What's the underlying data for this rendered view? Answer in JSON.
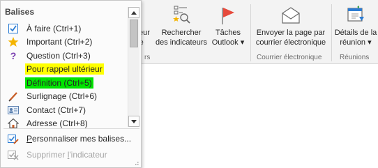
{
  "tags_menu": {
    "header": "Balises",
    "items": [
      {
        "icon": "checkbox-icon",
        "label": "À faire (Ctrl+1)"
      },
      {
        "icon": "star-icon",
        "label": "Important (Ctrl+2)"
      },
      {
        "icon": "question-mark-icon",
        "label": "Question (Ctrl+3)"
      },
      {
        "icon": "",
        "label": "Pour rappel ultérieur",
        "highlight": "#ffff00"
      },
      {
        "icon": "",
        "label": "Définition (Ctrl+5)",
        "highlight": "#00e400"
      },
      {
        "icon": "highlighter-pen-icon",
        "label": "Surlignage (Ctrl+6)"
      },
      {
        "icon": "contact-card-icon",
        "label": "Contact (Ctrl+7)"
      },
      {
        "icon": "house-icon",
        "label": "Adresse (Ctrl+8)"
      }
    ],
    "customize_prefix": "",
    "customize_accel": "P",
    "customize_rest": "ersonnaliser mes balises...",
    "remove_prefix": "Supprimer ",
    "remove_accel": "l",
    "remove_rest": "'indicateur",
    "remove_disabled": true
  },
  "ribbon": {
    "partial_button": {
      "line1": "teur",
      "line2": "re"
    },
    "find_tags": {
      "line1": "Rechercher",
      "line2": "des indicateurs"
    },
    "outlook_tasks": {
      "line1": "Tâches",
      "line2": "Outlook ▾"
    },
    "email_page": {
      "line1": "Envoyer la page par",
      "line2": "courrier électronique"
    },
    "meeting_details": {
      "line1": "Détails de la",
      "line2": "réunion ▾"
    },
    "groups": {
      "partial": "rs",
      "email": "Courrier électronique",
      "meetings": "Réunions"
    }
  },
  "colors": {
    "yellow_highlight": "#ffff00",
    "green_highlight": "#00e400",
    "flag_red": "#e64a3c",
    "accent_blue": "#2b7cd3"
  }
}
